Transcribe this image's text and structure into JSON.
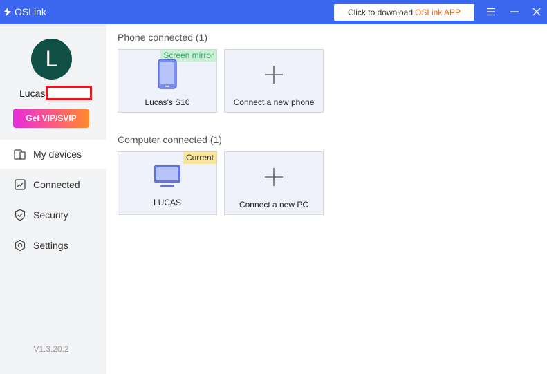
{
  "app": {
    "title": "OSLink"
  },
  "header": {
    "download_prefix": "Click to download",
    "download_accent": "OSLink APP",
    "accent_color": "#ee6a14"
  },
  "sidebar": {
    "avatar_initial": "L",
    "username": "Lucas",
    "vip_label": "Get VIP/SVIP",
    "items": [
      {
        "label": "My devices",
        "icon": "devices-icon",
        "active": true
      },
      {
        "label": "Connected",
        "icon": "connected-icon",
        "active": false
      },
      {
        "label": "Security",
        "icon": "shield-icon",
        "active": false
      },
      {
        "label": "Settings",
        "icon": "gear-icon",
        "active": false
      }
    ],
    "version": "V1.3.20.2"
  },
  "main": {
    "phones": {
      "title": "Phone connected (1)",
      "device": {
        "name": "Lucas's S10",
        "badge": "Screen mirror"
      },
      "add_label": "Connect a new phone"
    },
    "computers": {
      "title": "Computer connected (1)",
      "device": {
        "name": "LUCAS",
        "badge": "Current"
      },
      "add_label": "Connect a new PC"
    }
  },
  "colors": {
    "titlebar": "#3c67f0",
    "avatar": "#0f4f46",
    "card_bg": "#f0f2fb",
    "mirror_badge": "#ccefd8",
    "current_badge": "#f8e49a"
  }
}
